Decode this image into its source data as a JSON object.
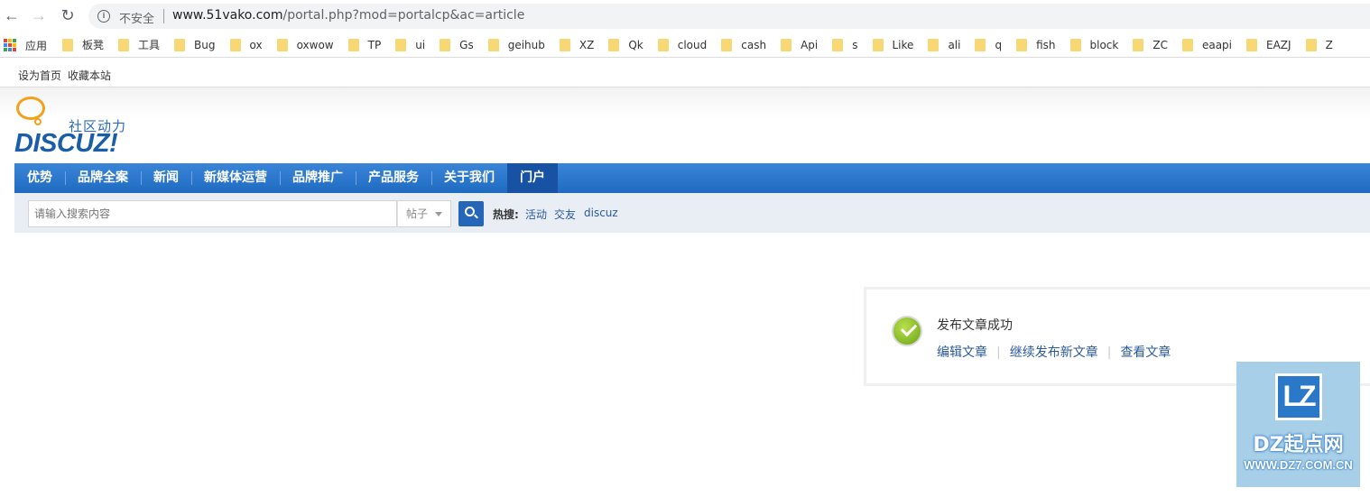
{
  "browser": {
    "security_label": "不安全",
    "url_host": "www.51vako.com",
    "url_path": "/portal.php?mod=portalcp&ac=article",
    "bookmarks_apps": "应用",
    "bookmarks": [
      "板凳",
      "工具",
      "Bug",
      "ox",
      "oxwow",
      "TP",
      "ui",
      "Gs",
      "geihub",
      "XZ",
      "Qk",
      "cloud",
      "cash",
      "Api",
      "s",
      "Like",
      "ali",
      "q",
      "fish",
      "block",
      "ZC",
      "eaapi",
      "EAZJ",
      "Z"
    ]
  },
  "topbar": {
    "set_home": "设为首页",
    "bookmark_site": "收藏本站"
  },
  "logo": {
    "slogan": "社区动力",
    "brand": "DISCUZ!"
  },
  "nav": {
    "items": [
      "优势",
      "品牌全案",
      "新闻",
      "新媒体运营",
      "品牌推广",
      "产品服务",
      "关于我们",
      "门户"
    ],
    "active_index": 7
  },
  "search": {
    "placeholder": "请输入搜索内容",
    "type": "帖子",
    "hot_label": "热搜:",
    "hot_links": [
      "活动",
      "交友",
      "discuz"
    ]
  },
  "message": {
    "text": "发布文章成功",
    "links": [
      "编辑文章",
      "继续发布新文章",
      "查看文章"
    ]
  },
  "watermark": {
    "badge": "LZ",
    "name": "DZ起点网",
    "url": "WWW.DZ7.COM.CN"
  }
}
